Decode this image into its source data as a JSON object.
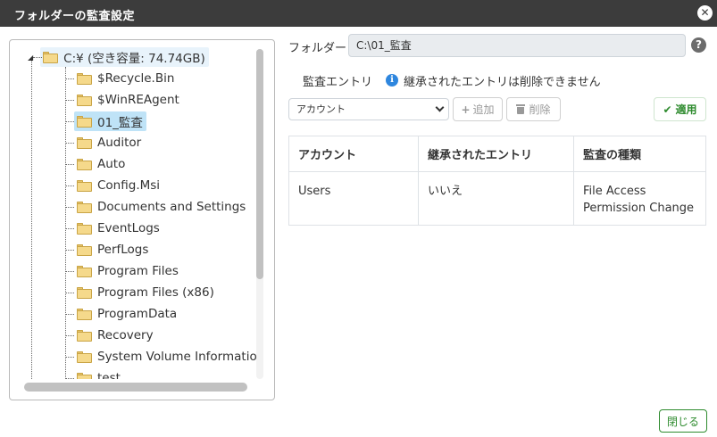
{
  "dialog": {
    "title": "フォルダーの監査設定",
    "close_icon": "close-icon"
  },
  "tree": {
    "root": {
      "label": "C:¥ (空き容量: 74.74GB)"
    },
    "items": [
      {
        "label": "$Recycle.Bin"
      },
      {
        "label": "$WinREAgent"
      },
      {
        "label": "01_監査",
        "selected": true
      },
      {
        "label": "Auditor"
      },
      {
        "label": "Auto"
      },
      {
        "label": "Config.Msi"
      },
      {
        "label": "Documents and Settings"
      },
      {
        "label": "EventLogs"
      },
      {
        "label": "PerfLogs"
      },
      {
        "label": "Program Files"
      },
      {
        "label": "Program Files (x86)"
      },
      {
        "label": "ProgramData"
      },
      {
        "label": "Recovery"
      },
      {
        "label": "System Volume Information"
      },
      {
        "label": "test"
      }
    ]
  },
  "folder": {
    "label": "フォルダー",
    "path": "C:\\01_監査",
    "help_icon": "question-icon"
  },
  "audit": {
    "section_label": "監査エントリ",
    "info_text": "継承されたエントリは削除できません",
    "account_select": {
      "selected": "アカウント"
    },
    "add_label": "追加",
    "delete_label": "削除",
    "apply_label": "適用",
    "table": {
      "headers": [
        "アカウント",
        "継承されたエントリ",
        "監査の種類"
      ],
      "rows": [
        {
          "account": "Users",
          "inherited": "いいえ",
          "type_line1": "File Access",
          "type_line2": "Permission Change"
        }
      ]
    }
  },
  "footer": {
    "close_label": "閉じる"
  },
  "colors": {
    "titlebar": "#3c3c3c",
    "accent_green": "#2e8b2e",
    "info_blue": "#2e86de",
    "selection": "#bfe3f7"
  }
}
